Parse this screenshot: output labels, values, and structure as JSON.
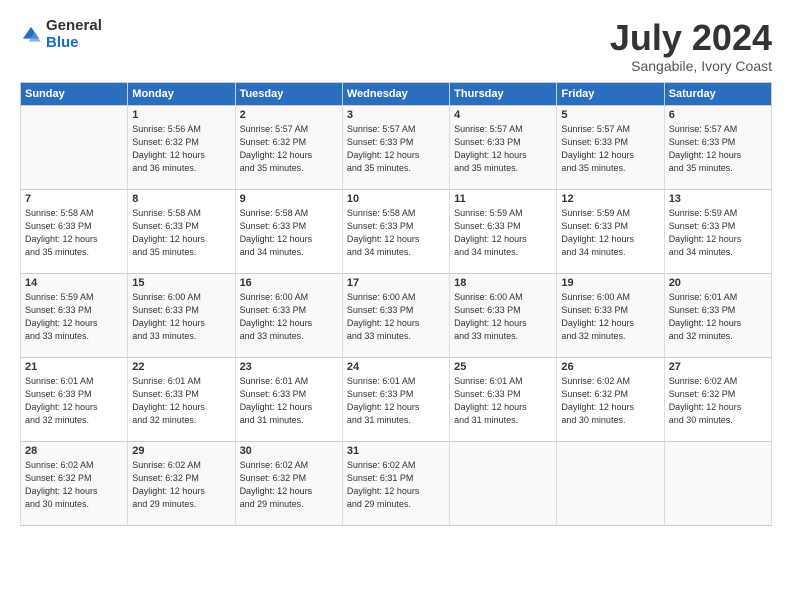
{
  "logo": {
    "general": "General",
    "blue": "Blue"
  },
  "title": "July 2024",
  "location": "Sangabile, Ivory Coast",
  "headers": [
    "Sunday",
    "Monday",
    "Tuesday",
    "Wednesday",
    "Thursday",
    "Friday",
    "Saturday"
  ],
  "weeks": [
    [
      {
        "num": "",
        "info": ""
      },
      {
        "num": "1",
        "info": "Sunrise: 5:56 AM\nSunset: 6:32 PM\nDaylight: 12 hours\nand 36 minutes."
      },
      {
        "num": "2",
        "info": "Sunrise: 5:57 AM\nSunset: 6:32 PM\nDaylight: 12 hours\nand 35 minutes."
      },
      {
        "num": "3",
        "info": "Sunrise: 5:57 AM\nSunset: 6:33 PM\nDaylight: 12 hours\nand 35 minutes."
      },
      {
        "num": "4",
        "info": "Sunrise: 5:57 AM\nSunset: 6:33 PM\nDaylight: 12 hours\nand 35 minutes."
      },
      {
        "num": "5",
        "info": "Sunrise: 5:57 AM\nSunset: 6:33 PM\nDaylight: 12 hours\nand 35 minutes."
      },
      {
        "num": "6",
        "info": "Sunrise: 5:57 AM\nSunset: 6:33 PM\nDaylight: 12 hours\nand 35 minutes."
      }
    ],
    [
      {
        "num": "7",
        "info": "Sunrise: 5:58 AM\nSunset: 6:33 PM\nDaylight: 12 hours\nand 35 minutes."
      },
      {
        "num": "8",
        "info": "Sunrise: 5:58 AM\nSunset: 6:33 PM\nDaylight: 12 hours\nand 35 minutes."
      },
      {
        "num": "9",
        "info": "Sunrise: 5:58 AM\nSunset: 6:33 PM\nDaylight: 12 hours\nand 34 minutes."
      },
      {
        "num": "10",
        "info": "Sunrise: 5:58 AM\nSunset: 6:33 PM\nDaylight: 12 hours\nand 34 minutes."
      },
      {
        "num": "11",
        "info": "Sunrise: 5:59 AM\nSunset: 6:33 PM\nDaylight: 12 hours\nand 34 minutes."
      },
      {
        "num": "12",
        "info": "Sunrise: 5:59 AM\nSunset: 6:33 PM\nDaylight: 12 hours\nand 34 minutes."
      },
      {
        "num": "13",
        "info": "Sunrise: 5:59 AM\nSunset: 6:33 PM\nDaylight: 12 hours\nand 34 minutes."
      }
    ],
    [
      {
        "num": "14",
        "info": "Sunrise: 5:59 AM\nSunset: 6:33 PM\nDaylight: 12 hours\nand 33 minutes."
      },
      {
        "num": "15",
        "info": "Sunrise: 6:00 AM\nSunset: 6:33 PM\nDaylight: 12 hours\nand 33 minutes."
      },
      {
        "num": "16",
        "info": "Sunrise: 6:00 AM\nSunset: 6:33 PM\nDaylight: 12 hours\nand 33 minutes."
      },
      {
        "num": "17",
        "info": "Sunrise: 6:00 AM\nSunset: 6:33 PM\nDaylight: 12 hours\nand 33 minutes."
      },
      {
        "num": "18",
        "info": "Sunrise: 6:00 AM\nSunset: 6:33 PM\nDaylight: 12 hours\nand 33 minutes."
      },
      {
        "num": "19",
        "info": "Sunrise: 6:00 AM\nSunset: 6:33 PM\nDaylight: 12 hours\nand 32 minutes."
      },
      {
        "num": "20",
        "info": "Sunrise: 6:01 AM\nSunset: 6:33 PM\nDaylight: 12 hours\nand 32 minutes."
      }
    ],
    [
      {
        "num": "21",
        "info": "Sunrise: 6:01 AM\nSunset: 6:33 PM\nDaylight: 12 hours\nand 32 minutes."
      },
      {
        "num": "22",
        "info": "Sunrise: 6:01 AM\nSunset: 6:33 PM\nDaylight: 12 hours\nand 32 minutes."
      },
      {
        "num": "23",
        "info": "Sunrise: 6:01 AM\nSunset: 6:33 PM\nDaylight: 12 hours\nand 31 minutes."
      },
      {
        "num": "24",
        "info": "Sunrise: 6:01 AM\nSunset: 6:33 PM\nDaylight: 12 hours\nand 31 minutes."
      },
      {
        "num": "25",
        "info": "Sunrise: 6:01 AM\nSunset: 6:33 PM\nDaylight: 12 hours\nand 31 minutes."
      },
      {
        "num": "26",
        "info": "Sunrise: 6:02 AM\nSunset: 6:32 PM\nDaylight: 12 hours\nand 30 minutes."
      },
      {
        "num": "27",
        "info": "Sunrise: 6:02 AM\nSunset: 6:32 PM\nDaylight: 12 hours\nand 30 minutes."
      }
    ],
    [
      {
        "num": "28",
        "info": "Sunrise: 6:02 AM\nSunset: 6:32 PM\nDaylight: 12 hours\nand 30 minutes."
      },
      {
        "num": "29",
        "info": "Sunrise: 6:02 AM\nSunset: 6:32 PM\nDaylight: 12 hours\nand 29 minutes."
      },
      {
        "num": "30",
        "info": "Sunrise: 6:02 AM\nSunset: 6:32 PM\nDaylight: 12 hours\nand 29 minutes."
      },
      {
        "num": "31",
        "info": "Sunrise: 6:02 AM\nSunset: 6:31 PM\nDaylight: 12 hours\nand 29 minutes."
      },
      {
        "num": "",
        "info": ""
      },
      {
        "num": "",
        "info": ""
      },
      {
        "num": "",
        "info": ""
      }
    ]
  ]
}
